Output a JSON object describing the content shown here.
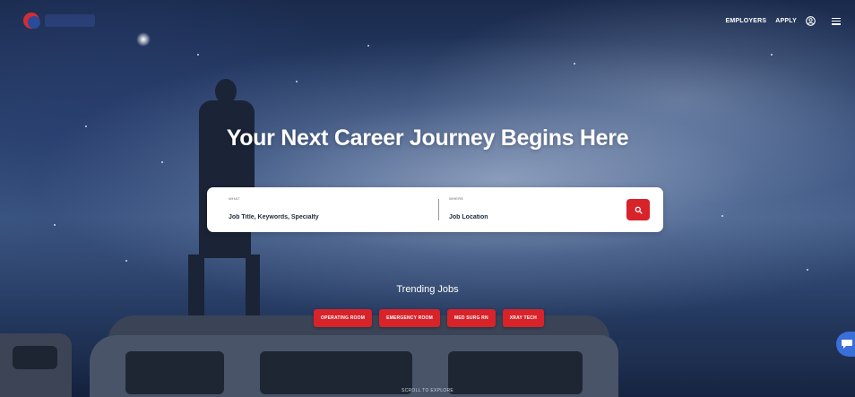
{
  "header": {
    "nav": {
      "employers_label": "EMPLOYERS",
      "apply_label": "APPLY"
    },
    "icons": [
      "account-icon",
      "menu-icon"
    ]
  },
  "hero": {
    "headline": "Your Next Career Journey Begins Here"
  },
  "search": {
    "what": {
      "label": "WHAT",
      "placeholder": "Job Title, Keywords, Specialty"
    },
    "where": {
      "label": "WHERE",
      "placeholder": "Job Location"
    },
    "button_icon": "search-icon"
  },
  "trending": {
    "title": "Trending Jobs",
    "chips": [
      "OPERATING ROOM",
      "EMERGENCY ROOM",
      "MED SURG RN",
      "XRAY TECH"
    ]
  },
  "scroll_hint": "SCROLL TO EXPLORE",
  "chat": {
    "icon": "chat-icon"
  },
  "colors": {
    "accent": "#d8232a",
    "chat": "#3a6ed8",
    "text_dark": "#1e2a3a"
  }
}
